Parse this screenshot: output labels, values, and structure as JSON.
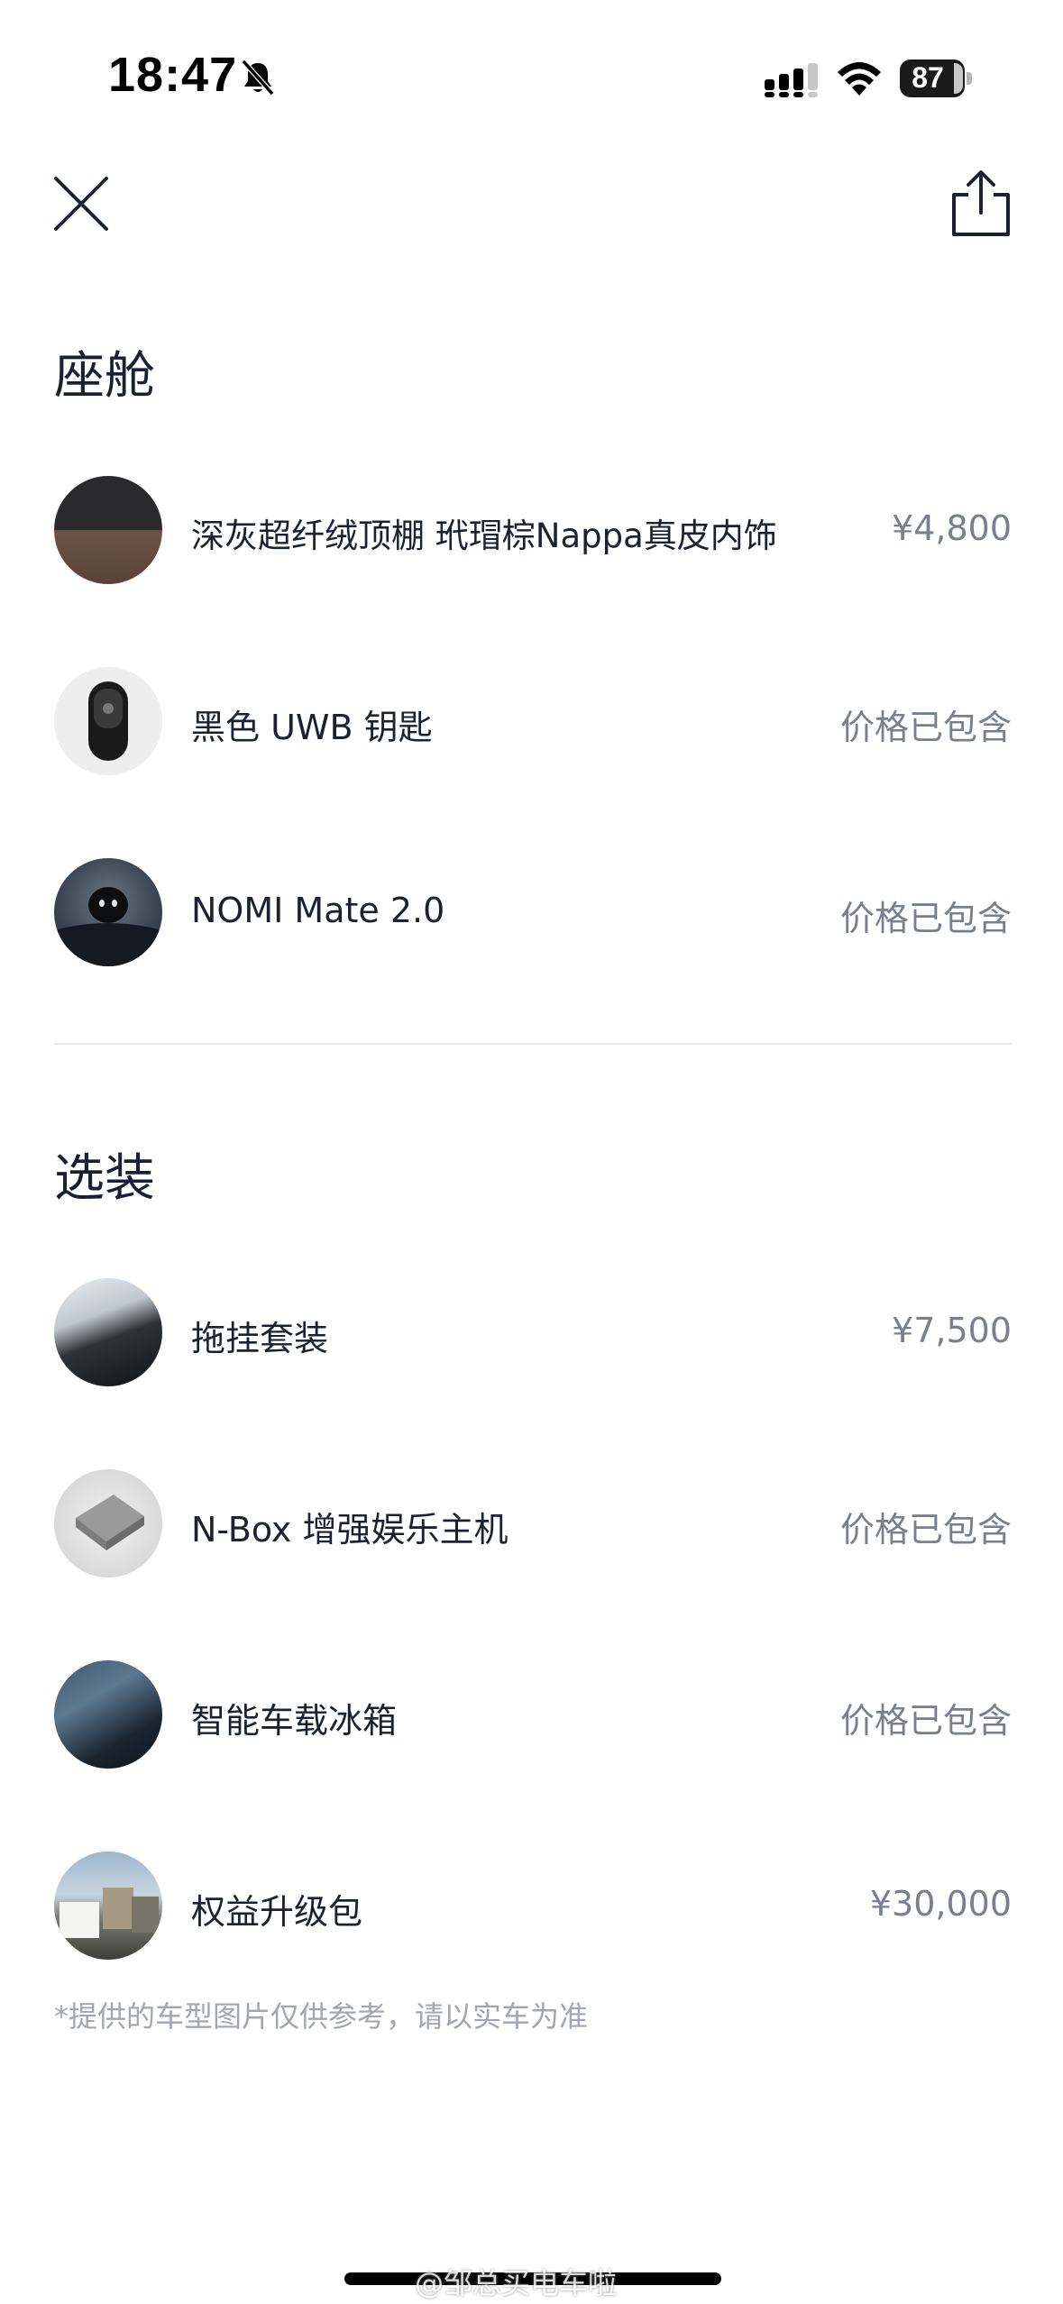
{
  "status_bar": {
    "time": "18:47",
    "battery": "87",
    "icons": [
      "bell-muted-icon",
      "cellular-signal-icon",
      "wifi-icon",
      "battery-icon"
    ]
  },
  "nav": {
    "close_icon": "close-icon",
    "share_icon": "share-icon"
  },
  "cabin": {
    "title": "座舱",
    "items": [
      {
        "name": "深灰超纤绒顶棚 玳瑁棕Nappa真皮内饰",
        "price": "¥4,800"
      },
      {
        "name": "黑色 UWB 钥匙",
        "price": "价格已包含"
      },
      {
        "name": "NOMI Mate 2.0",
        "price": "价格已包含"
      }
    ]
  },
  "options": {
    "title": "选装",
    "items": [
      {
        "name": "拖挂套装",
        "price": "¥7,500"
      },
      {
        "name": "N-Box 增强娱乐主机",
        "price": "价格已包含"
      },
      {
        "name": "智能车载冰箱",
        "price": "价格已包含"
      },
      {
        "name": "权益升级包",
        "price": "¥30,000"
      }
    ]
  },
  "disclaimer": "*提供的车型图片仅供参考，请以实车为准",
  "watermark": "@邹总买电车啦",
  "colors": {
    "text_primary": "#1c2132",
    "text_secondary": "#7a7f8d",
    "text_muted": "#a3a6b0",
    "divider": "#e8e9ec"
  }
}
